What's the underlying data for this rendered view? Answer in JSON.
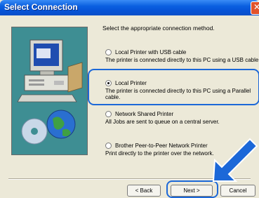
{
  "window": {
    "title": "Select Connection"
  },
  "instruction": "Select the appropriate connection method.",
  "options": [
    {
      "label": "Local Printer with USB cable",
      "description": "The printer is connected directly to this PC using a USB cable.",
      "selected": false
    },
    {
      "label": "Local Printer",
      "description": "The printer is connected directly to this PC using a Parallel cable.",
      "selected": true
    },
    {
      "label": "Network Shared Printer",
      "description": "All Jobs are sent to queue on a central server.",
      "selected": false
    },
    {
      "label": "Brother Peer-to-Peer Network Printer",
      "description": "Print directly to the printer over the network.",
      "selected": false
    }
  ],
  "buttons": {
    "back": "< Back",
    "next": "Next >",
    "cancel": "Cancel"
  },
  "colors": {
    "title_bar": "#0a5fe0",
    "highlight": "#1c68d8",
    "side_panel": "#3e8e93"
  },
  "icons": {
    "close": "close-icon",
    "computer": "computer-illustration",
    "arrow": "pointer-arrow"
  }
}
